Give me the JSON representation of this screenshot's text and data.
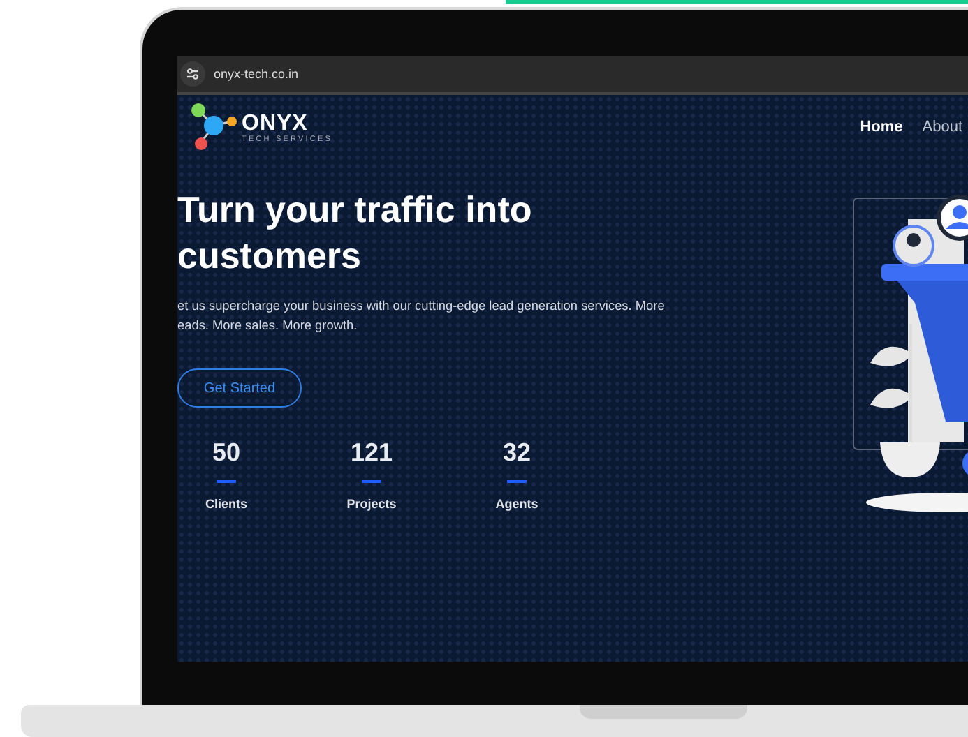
{
  "browser": {
    "url": "onyx-tech.co.in"
  },
  "logo": {
    "name": "ONYX",
    "tagline": "TECH SERVICES"
  },
  "nav": [
    {
      "label": "Home",
      "selected": true
    },
    {
      "label": "About",
      "selected": false
    }
  ],
  "hero": {
    "title": "Turn your traffic into customers",
    "description_lines": [
      "et us supercharge your business with our cutting-edge lead generation services. More",
      "eads. More sales. More growth."
    ],
    "button": "Get Started"
  },
  "stats": [
    {
      "value": "50",
      "label": "Clients"
    },
    {
      "value": "121",
      "label": "Projects"
    },
    {
      "value": "32",
      "label": "Agents"
    }
  ]
}
